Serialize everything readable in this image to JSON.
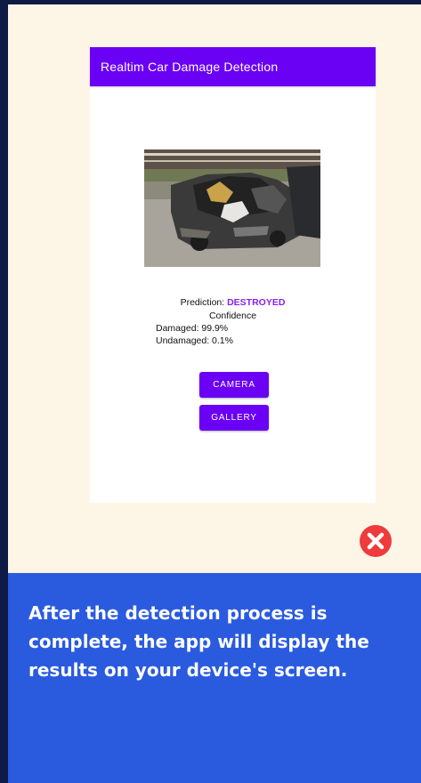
{
  "app": {
    "title": "Realtim Car Damage Detection"
  },
  "result": {
    "prediction_label": "Prediction:",
    "prediction_value": "DESTROYED",
    "confidence_title": "Confidence",
    "damaged": "Damaged: 99.9%",
    "undamaged": "Undamaged: 0.1%"
  },
  "buttons": {
    "camera": "CAMERA",
    "gallery": "GALLERY"
  },
  "icons": {
    "close": "close-icon"
  },
  "footer": {
    "text": "After the detection process is complete, the app will display the results on your device's screen."
  },
  "colors": {
    "accent": "#6a00f4",
    "prediction": "#8a1ff0",
    "footer_bg": "#2a5bdf",
    "close": "#ef3b3b",
    "panel_bg": "#fdf6e6"
  }
}
